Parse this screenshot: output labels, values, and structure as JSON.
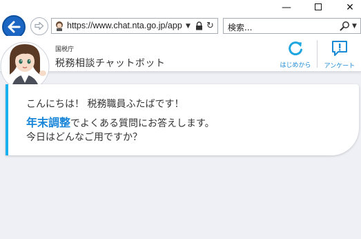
{
  "window": {
    "minimize_glyph": "—",
    "close_glyph": "✕"
  },
  "browser": {
    "url_main": "https://www.chat.nta.go.jp/app",
    "search_placeholder": "検索..."
  },
  "header": {
    "agency": "国税庁",
    "title": "税務相談チャットボット",
    "restart_label": "はじめから",
    "survey_label": "アンケート",
    "accent_color": "#1a8ad4"
  },
  "chat": {
    "greeting": "こんにちは！ 税務職員ふたばです！",
    "highlight": "年末調整",
    "line2_rest": "でよくある質問にお答えします。",
    "question": "今日はどんなご用ですか？",
    "accent_color": "#19b0ee"
  }
}
